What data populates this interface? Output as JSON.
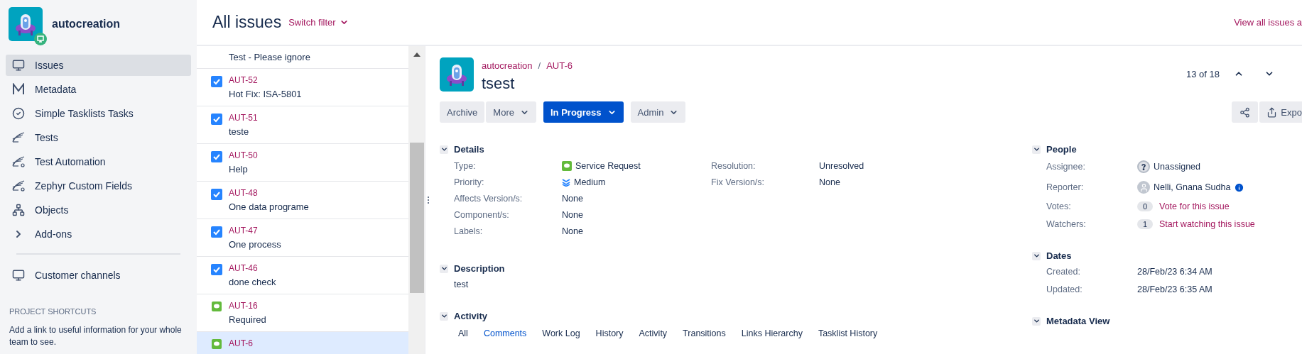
{
  "project": {
    "name": "autocreation"
  },
  "sidebar": {
    "items": [
      {
        "label": "Issues",
        "selected": true
      },
      {
        "label": "Metadata",
        "selected": false
      },
      {
        "label": "Simple Tasklists Tasks",
        "selected": false
      },
      {
        "label": "Tests",
        "selected": false
      },
      {
        "label": "Test Automation",
        "selected": false
      },
      {
        "label": "Zephyr Custom Fields",
        "selected": false
      },
      {
        "label": "Objects",
        "selected": false
      },
      {
        "label": "Add-ons",
        "selected": false
      }
    ],
    "channels": {
      "label": "Customer channels"
    },
    "shortcuts": {
      "heading": "PROJECT SHORTCUTS",
      "text": "Add a link to useful information for your whole team to see."
    }
  },
  "header": {
    "title": "All issues",
    "filter": "Switch filter",
    "view_all": "View all issues a"
  },
  "issues": [
    {
      "summary": "Test - Please ignore",
      "kind": "partial",
      "selected": false
    },
    {
      "key": "AUT-52",
      "summary": "Hot Fix: ISA-5801",
      "kind": "task",
      "selected": false
    },
    {
      "key": "AUT-51",
      "summary": "teste",
      "kind": "task",
      "selected": false
    },
    {
      "key": "AUT-50",
      "summary": "Help",
      "kind": "task",
      "selected": false
    },
    {
      "key": "AUT-48",
      "summary": "One data programe",
      "kind": "task",
      "selected": false
    },
    {
      "key": "AUT-47",
      "summary": "One process",
      "kind": "task",
      "selected": false
    },
    {
      "key": "AUT-46",
      "summary": "done check",
      "kind": "task",
      "selected": false
    },
    {
      "key": "AUT-16",
      "summary": "Required",
      "kind": "service",
      "selected": false
    },
    {
      "key": "AUT-6",
      "kind": "service",
      "selected": true
    }
  ],
  "issue": {
    "project": "autocreation",
    "separator": "/",
    "key": "AUT-6",
    "title": "tsest",
    "counter": "13 of 18",
    "actions": [
      {
        "label": "Archive",
        "kind": "plain"
      },
      {
        "label": "More",
        "kind": "menu"
      },
      {
        "label": "In Progress",
        "kind": "primary"
      },
      {
        "label": "Admin",
        "kind": "menu"
      }
    ],
    "export": "Expo",
    "details": {
      "title": "Details",
      "expanded": true,
      "left": [
        {
          "label": "Type:",
          "value": "Service Request",
          "kind": "issue-type"
        },
        {
          "label": "Priority:",
          "value": "Medium",
          "kind": "priority"
        },
        {
          "label": "Affects Version/s:",
          "value": "None"
        },
        {
          "label": "Component/s:",
          "value": "None"
        },
        {
          "label": "Labels:",
          "value": "None"
        }
      ],
      "right": [
        {
          "label": "Resolution:",
          "value": "Unresolved"
        },
        {
          "label": "Fix Version/s:",
          "value": "None"
        }
      ]
    },
    "description": {
      "title": "Description",
      "expanded": true,
      "text": "test"
    },
    "activity": {
      "title": "Activity",
      "expanded": true,
      "tabs": [
        {
          "label": "All",
          "selected": false
        },
        {
          "label": "Comments",
          "selected": true
        },
        {
          "label": "Work Log",
          "selected": false
        },
        {
          "label": "History",
          "selected": false
        },
        {
          "label": "Activity",
          "selected": false
        },
        {
          "label": "Transitions",
          "selected": false
        },
        {
          "label": "Links Hierarchy",
          "selected": false
        },
        {
          "label": "Tasklist History",
          "selected": false
        }
      ]
    },
    "people": {
      "title": "People",
      "expanded": true,
      "rows": [
        {
          "label": "Assignee:",
          "value": "Unassigned",
          "kind": "unknown-user"
        },
        {
          "label": "Reporter:",
          "value": "Nelli, Gnana Sudha",
          "kind": "user"
        },
        {
          "label": "Votes:",
          "count": "0",
          "value": "Vote for this issue",
          "kind": "counter"
        },
        {
          "label": "Watchers:",
          "count": "1",
          "value": "Start watching this issue",
          "kind": "counter"
        }
      ]
    },
    "dates": {
      "title": "Dates",
      "expanded": true,
      "rows": [
        {
          "label": "Created:",
          "value": "28/Feb/23 6:34 AM"
        },
        {
          "label": "Updated:",
          "value": "28/Feb/23 6:35 AM"
        }
      ]
    },
    "metadata": {
      "title": "Metadata View",
      "expanded": true
    }
  }
}
